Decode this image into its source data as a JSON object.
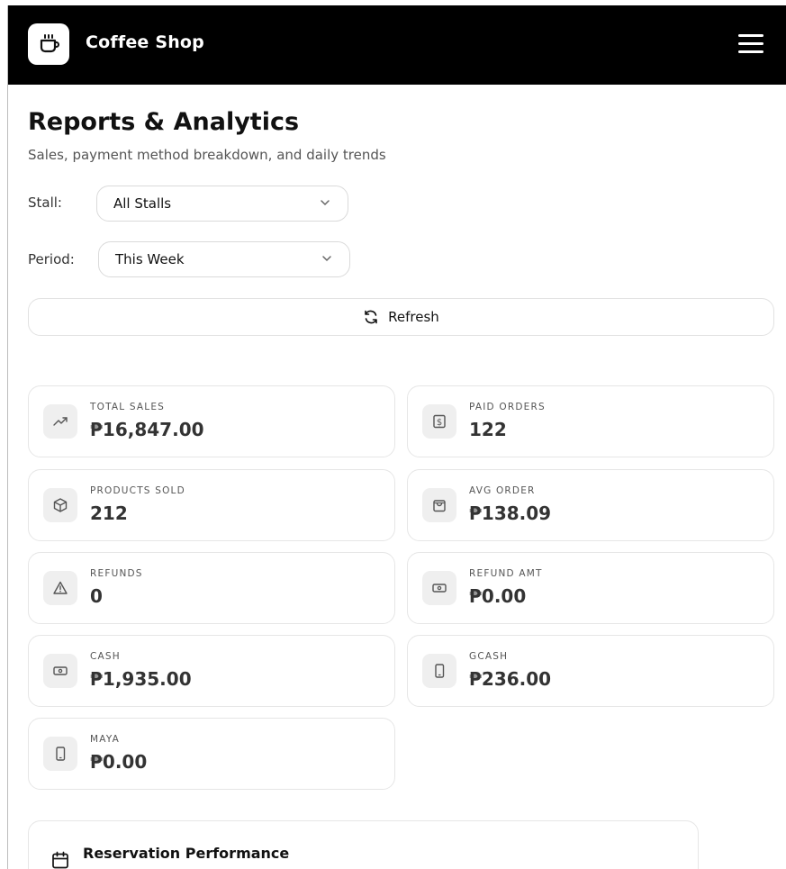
{
  "header": {
    "brand": "Coffee Shop",
    "logo_icon": "coffee-cup-icon",
    "menu_icon": "hamburger-menu-icon",
    "background": "#000000"
  },
  "page": {
    "title": "Reports & Analytics",
    "subtitle": "Sales, payment method breakdown, and daily trends"
  },
  "filters": {
    "stall_label": "Stall:",
    "stall_value": "All Stalls",
    "period_label": "Period:",
    "period_value": "This Week"
  },
  "refresh": {
    "label": "Refresh",
    "icon": "refresh-icon"
  },
  "stats": [
    {
      "label": "TOTAL SALES",
      "value": "₱16,847.00",
      "icon": "trending-up-icon"
    },
    {
      "label": "PAID ORDERS",
      "value": "122",
      "icon": "dollar-receipt-icon"
    },
    {
      "label": "PRODUCTS SOLD",
      "value": "212",
      "icon": "package-icon"
    },
    {
      "label": "AVG ORDER",
      "value": "₱138.09",
      "icon": "shopping-bag-icon"
    },
    {
      "label": "REFUNDS",
      "value": "0",
      "icon": "warning-triangle-icon"
    },
    {
      "label": "REFUND AMT",
      "value": "₱0.00",
      "icon": "banknote-icon"
    },
    {
      "label": "CASH",
      "value": "₱1,935.00",
      "icon": "banknote-icon"
    },
    {
      "label": "GCASH",
      "value": "₱236.00",
      "icon": "smartphone-icon"
    },
    {
      "label": "MAYA",
      "value": "₱0.00",
      "icon": "smartphone-icon"
    }
  ],
  "reservations": {
    "title": "Reservation Performance",
    "subtitle": "",
    "icon": "calendar-icon"
  }
}
